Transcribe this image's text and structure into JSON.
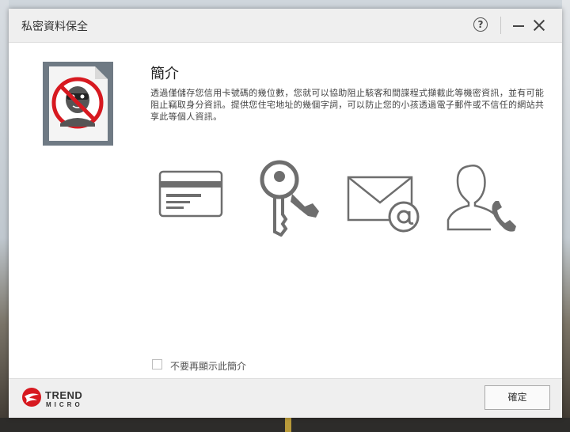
{
  "window": {
    "title": "私密資料保全",
    "help_label": "?"
  },
  "intro": {
    "heading": "簡介",
    "description": "透過僅儲存您信用卡號碼的幾位數，您就可以協助阻止駭客和間諜程式擷截此等機密資訊，並有可能阻止竊取身分資訊。提供您住宅地址的幾個字詞，可以防止您的小孩透過電子郵件或不信任的網站共享此等個人資訊。"
  },
  "features": {
    "icons": [
      "credit-card-icon",
      "key-icon",
      "email-icon",
      "contact-phone-icon"
    ]
  },
  "footer": {
    "dont_show_label": "不要再顯示此簡介",
    "brand_line1": "TREND",
    "brand_line2": "MICRO",
    "ok_label": "確定"
  },
  "colors": {
    "accent_red": "#d71920",
    "icon_gray": "#6e6e6e"
  }
}
